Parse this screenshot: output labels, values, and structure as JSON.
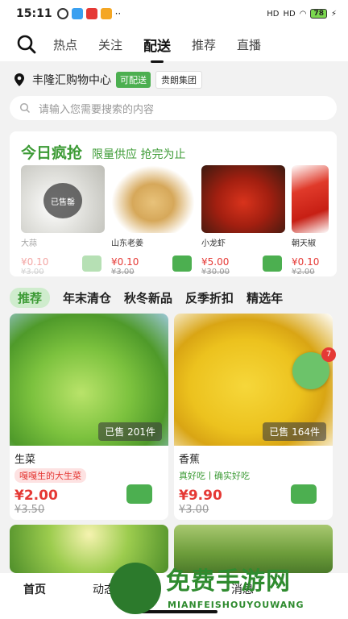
{
  "status": {
    "time": "15:11",
    "signal1": "HD",
    "signal2": "HD",
    "battery": "78"
  },
  "tabs": [
    "热点",
    "关注",
    "配送",
    "推荐",
    "直播"
  ],
  "active_tab": "配送",
  "location": {
    "name": "丰隆汇购物中心",
    "delivery_badge": "可配送",
    "group_badge": "贵朗集团"
  },
  "search": {
    "placeholder": "请输入您需要搜索的内容"
  },
  "deal": {
    "title": "今日疯抢",
    "subtitle": "限量供应 抢完为止",
    "items": [
      {
        "name": "大蒜",
        "price": "¥0.10",
        "old": "¥3.00",
        "sold_out": "已售罄"
      },
      {
        "name": "山东老姜",
        "price": "¥0.10",
        "old": "¥3.00"
      },
      {
        "name": "小龙虾",
        "price": "¥5.00",
        "old": "¥30.00"
      },
      {
        "name": "朝天椒",
        "price": "¥0.10",
        "old": "¥2.00"
      }
    ]
  },
  "categories": [
    "推荐",
    "年末清仓",
    "秋冬新品",
    "反季折扣",
    "精选年"
  ],
  "products": [
    {
      "title": "生菜",
      "tag": "嘎嘎生的大生菜",
      "price": "¥2.00",
      "old": "¥3.50",
      "sold": "已售 201件"
    },
    {
      "title": "香蕉",
      "tag": "真好吃丨确实好吃",
      "price": "¥9.90",
      "old": "¥3.00",
      "sold": "已售 164件"
    }
  ],
  "cart_count": "7",
  "bottom_nav": [
    "首页",
    "动态",
    "",
    "消息",
    ""
  ],
  "watermark": {
    "big": "免费手游网",
    "small": "MIANFEISHOUYOUWANG"
  },
  "colors": {
    "accent": "#4caf50",
    "price": "#e53935"
  }
}
